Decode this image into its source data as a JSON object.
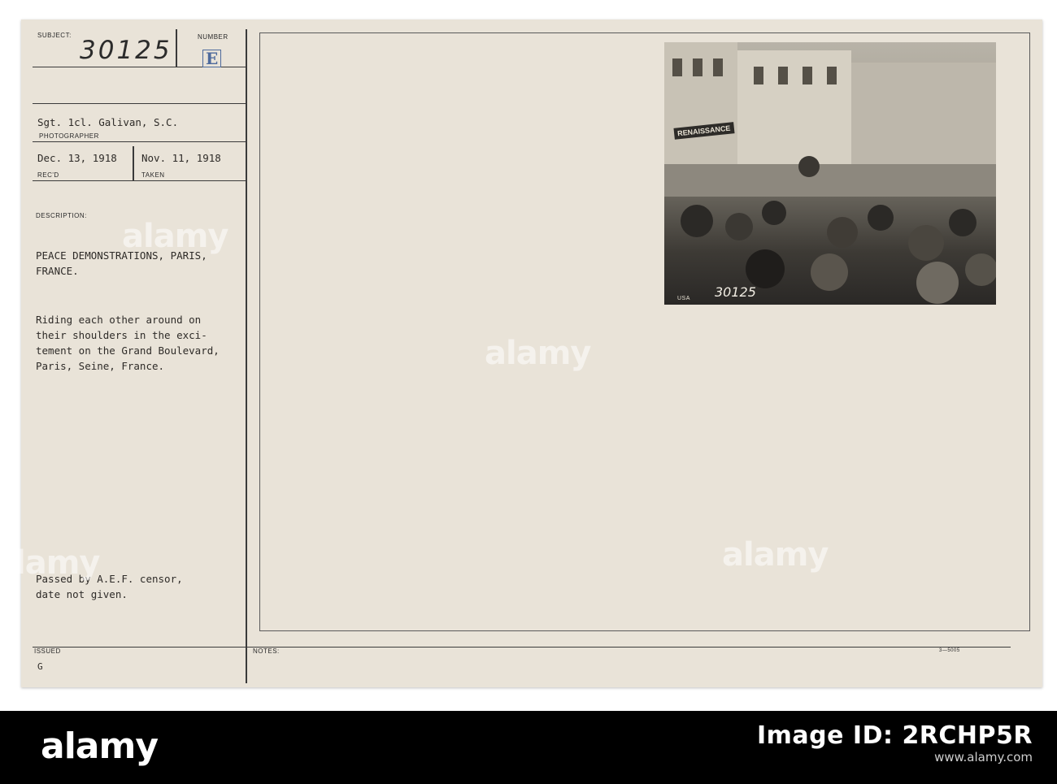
{
  "card": {
    "subject_label": "SUBJECT:",
    "subject_value": "30125",
    "number_label": "NUMBER",
    "number_value": "E",
    "photographer_value": "Sgt. 1cl. Galivan, S.C.",
    "photographer_label": "PHOTOGRAPHER",
    "received_value": "Dec. 13, 1918",
    "received_label": "REC'D",
    "taken_value": "Nov. 11, 1918",
    "taken_label": "TAKEN",
    "description_label": "DESCRIPTION:",
    "title_line1": "PEACE DEMONSTRATIONS, PARIS,",
    "title_line2": "FRANCE.",
    "desc_line1": "Riding each other around on",
    "desc_line2": "their shoulders in the exci-",
    "desc_line3": "tement on the Grand Boulevard,",
    "desc_line4": "Paris, Seine, France.",
    "censor_line1": "Passed by A.E.F. censor,",
    "censor_line2": "date not given.",
    "issued_label": "ISSUED",
    "issued_value": "G",
    "notes_label": "NOTES:",
    "form_code": "3—5005"
  },
  "photo": {
    "sign_text": "RENAISSANCE",
    "negative_number": "30125",
    "stamp_text": "USA"
  },
  "watermark": {
    "text": "alamy"
  },
  "stock": {
    "logo": "alamy",
    "image_id_label": "Image ID: 2RCHP5R",
    "site": "www.alamy.com"
  }
}
